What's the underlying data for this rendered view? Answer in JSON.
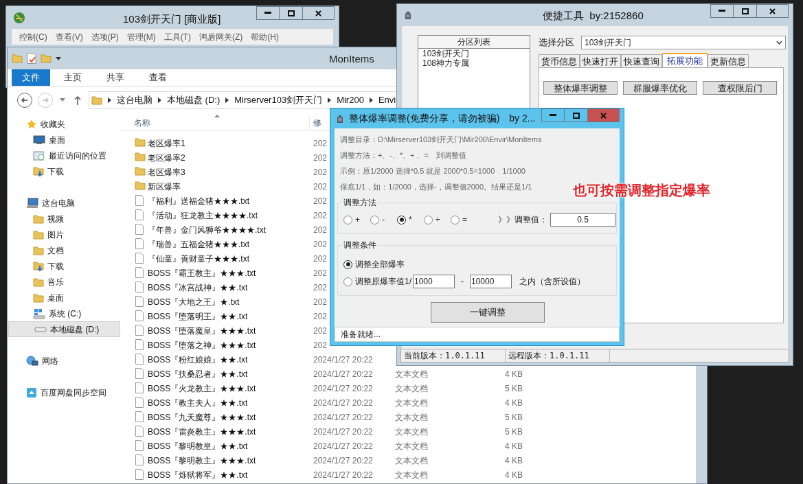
{
  "back_window": {
    "title": "103剑开天门 [商业版]",
    "menu": [
      "控制(C)",
      "查看(V)",
      "选项(P)",
      "管理(M)",
      "工具(T)",
      "鸿盾网关(Z)",
      "帮助(H)"
    ]
  },
  "explorer": {
    "title": "MonItems",
    "ribbon_tabs": [
      {
        "label": "文件",
        "kind": "file"
      },
      {
        "label": "主页",
        "kind": "tab"
      },
      {
        "label": "共享",
        "kind": "tab"
      },
      {
        "label": "查看",
        "kind": "tab"
      }
    ],
    "breadcrumb": [
      "这台电脑",
      "本地磁盘 (D:)",
      "Mirserver103剑开天门",
      "Mir200",
      "Envi"
    ],
    "nav": [
      {
        "label": "收藏夹",
        "kind": "star",
        "selected": false,
        "children": [
          {
            "label": "桌面",
            "kind": "desktop",
            "selected": false
          },
          {
            "label": "最近访问的位置",
            "kind": "recent",
            "selected": false
          },
          {
            "label": "下载",
            "kind": "download",
            "selected": false
          }
        ]
      },
      {
        "label": "这台电脑",
        "kind": "computer",
        "selected": false,
        "children": [
          {
            "label": "视频",
            "kind": "folder",
            "selected": false
          },
          {
            "label": "图片",
            "kind": "folder",
            "selected": false
          },
          {
            "label": "文档",
            "kind": "folder",
            "selected": false
          },
          {
            "label": "下载",
            "kind": "download",
            "selected": false
          },
          {
            "label": "音乐",
            "kind": "folder",
            "selected": false
          },
          {
            "label": "桌面",
            "kind": "folder",
            "selected": false
          },
          {
            "label": "系统 (C:)",
            "kind": "system-drive",
            "selected": false
          },
          {
            "label": "本地磁盘 (D:)",
            "kind": "drive",
            "selected": true
          }
        ]
      },
      {
        "label": "网络",
        "kind": "network",
        "selected": false
      },
      {
        "label": "百度网盘同步空间",
        "kind": "cloud",
        "selected": false
      }
    ],
    "columns": [
      "名称",
      "修"
    ],
    "files": [
      {
        "name": "老区爆率1",
        "kind": "folder",
        "date": "202"
      },
      {
        "name": "老区爆率2",
        "kind": "folder",
        "date": "202"
      },
      {
        "name": "老区爆率3",
        "kind": "folder",
        "date": "202"
      },
      {
        "name": "新区爆率",
        "kind": "folder",
        "date": "202"
      },
      {
        "name": "『福利』送福金猪★★★.txt",
        "kind": "file",
        "date": "202"
      },
      {
        "name": "『活动』狂龙教主★★★★.txt",
        "kind": "file",
        "date": "202"
      },
      {
        "name": "『年兽』金门风狮爷★★★★.txt",
        "kind": "file",
        "date": "202"
      },
      {
        "name": "『瑞兽』五福金猪★★★.txt",
        "kind": "file",
        "date": "202"
      },
      {
        "name": "『仙童』善财童子★★★.txt",
        "kind": "file",
        "date": "202"
      },
      {
        "name": "BOSS『霸王教主』★★★.txt",
        "kind": "file",
        "date": "202"
      },
      {
        "name": "BOSS『冰宫战神』★★.txt",
        "kind": "file",
        "date": "202"
      },
      {
        "name": "BOSS『大地之王』★.txt",
        "kind": "file",
        "date": "202"
      },
      {
        "name": "BOSS『堕落明王』★★.txt",
        "kind": "file",
        "date": "202"
      },
      {
        "name": "BOSS『堕落魔皇』★★★.txt",
        "kind": "file",
        "date": "202"
      },
      {
        "name": "BOSS『堕落之神』★★★.txt",
        "kind": "file",
        "date": "202"
      },
      {
        "name": "BOSS『粉红娘娘』★★.txt",
        "kind": "file",
        "date": "2024/1/27 20:22"
      },
      {
        "name": "BOSS『扶桑忍者』★★.txt",
        "kind": "file",
        "date": "2024/1/27 20:22",
        "type": "文本文档",
        "size": "4 KB"
      },
      {
        "name": "BOSS『火龙教主』★★★.txt",
        "kind": "file",
        "date": "2024/1/27 20:22",
        "type": "文本文档",
        "size": "5 KB"
      },
      {
        "name": "BOSS『教主夫人』★★.txt",
        "kind": "file",
        "date": "2024/1/27 20:22",
        "type": "文本文档",
        "size": "4 KB"
      },
      {
        "name": "BOSS『九天魔尊』★★★.txt",
        "kind": "file",
        "date": "2024/1/27 20:22",
        "type": "文本文档",
        "size": "5 KB"
      },
      {
        "name": "BOSS『雷炎教主』★★★.txt",
        "kind": "file",
        "date": "2024/1/27 20:22",
        "type": "文本文档",
        "size": "5 KB"
      },
      {
        "name": "BOSS『黎明教皇』★★.txt",
        "kind": "file",
        "date": "2024/1/27 20:22",
        "type": "文本文档",
        "size": "4 KB"
      },
      {
        "name": "BOSS『黎明教主』★★★.txt",
        "kind": "file",
        "date": "2024/1/27 20:22",
        "type": "文本文档",
        "size": "4 KB"
      },
      {
        "name": "BOSS『烁狱将军』★★.txt",
        "kind": "file",
        "date": "2024/1/27 20:22",
        "type": "文本文档",
        "size": "4 KB"
      }
    ]
  },
  "tool_window": {
    "title": "便捷工具  by:2152860",
    "list_header": "分区列表",
    "list_items": [
      "103剑开天门",
      "108神力专属"
    ],
    "select_label": "选择分区",
    "select_value": "103剑开天门",
    "tabs": [
      {
        "label": "货币信息",
        "selected": false
      },
      {
        "label": "快速打开",
        "selected": false
      },
      {
        "label": "快速查询",
        "selected": false
      },
      {
        "label": "拓展功能",
        "selected": true
      },
      {
        "label": "更新信息",
        "selected": false
      }
    ],
    "buttons": [
      "整体爆率调整",
      "群服爆率优化",
      "查权限后门"
    ],
    "status": [
      "当前版本：1.0.1.11",
      "远程版本：1.0.1.11"
    ]
  },
  "dialog": {
    "title": "整体爆率调整(免费分享，请勿被骗)　by 2...",
    "info": [
      "调整目录：D:\\Mirserver103剑开天门\\Mir200\\Envir\\MonItems",
      "调整方法：+、-、*、÷ 、=　到调整值",
      "示例：原1/2000 选择*0.5 就是 2000*0.5=1000　1/1000",
      "保底1/1，如：1/2000，选择-，调整值2000。结果还是1/1"
    ],
    "method_group": {
      "title": "调整方法",
      "options": [
        {
          "label": "+",
          "selected": false
        },
        {
          "label": "-",
          "selected": false
        },
        {
          "label": "*",
          "selected": true
        },
        {
          "label": "÷",
          "selected": false
        },
        {
          "label": "=",
          "selected": false
        }
      ],
      "value_label": "》》调整值：",
      "value": "0.5"
    },
    "condition_group": {
      "title": "调整条件",
      "options": [
        {
          "label": "调整全部爆率",
          "selected": true
        },
        {
          "label": "调整原爆率值1/",
          "selected": false
        }
      ],
      "min": "1000",
      "separator": "-",
      "max": "10000",
      "suffix": "之内（含所设值）"
    },
    "button": "一键调整",
    "status": "准备就绪..."
  },
  "annotation": "也可按需调整指定爆率"
}
